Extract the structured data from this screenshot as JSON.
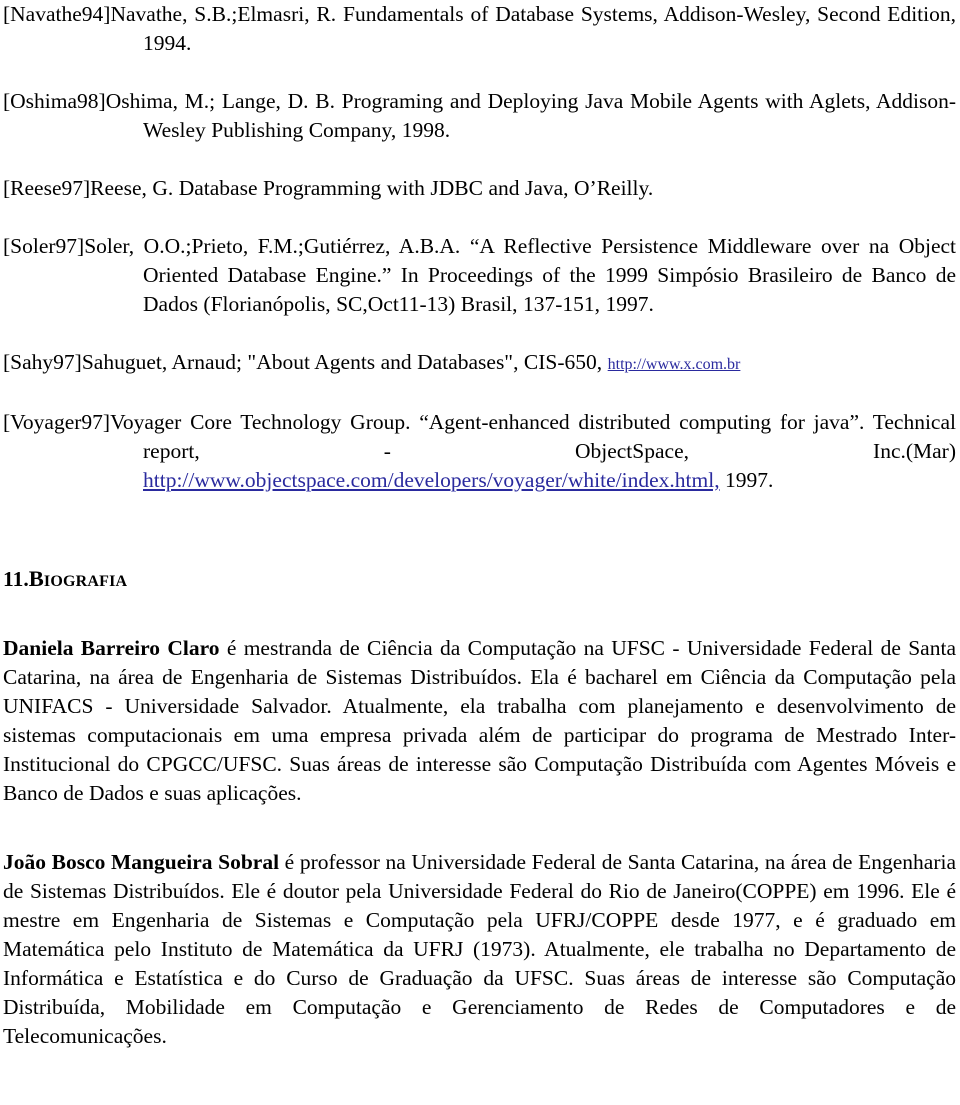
{
  "document": {
    "references": [
      {
        "key": "[Navathe94]",
        "text": "Navathe, S.B.;Elmasri, R. Fundamentals of Database Systems, Addison-Wesley, Second Edition, 1994."
      },
      {
        "key": "[Oshima98]",
        "text": "Oshima, M.; Lange, D. B. Programing and Deploying Java Mobile Agents with Aglets, Addison-Wesley Publishing Company, 1998."
      },
      {
        "key": "[Reese97]",
        "text": "Reese, G. Database Programming with JDBC and Java, O’Reilly."
      },
      {
        "key": "[Soler97]",
        "text": "Soler, O.O.;Prieto, F.M.;Gutiérrez, A.B.A. “A Reflective Persistence Middleware over na Object Oriented Database Engine.” In Proceedings of the 1999 Simpósio Brasileiro de Banco de Dados (Florianópolis, SC,Oct11-13) Brasil, 137-151, 1997."
      },
      {
        "key": "[Sahy97]",
        "text_before": "Sahuguet, Arnaud; \"About Agents and Databases\", CIS-650, ",
        "link": "http://www.x.com.br",
        "text_after": ""
      },
      {
        "key": "[Voyager97]",
        "text_before": "Voyager Core Technology Group. “Agent-enhanced distributed computing for java”. Technical report, - ObjectSpace, Inc.(Mar) ",
        "link": "http://www.objectspace.com/developers/voyager/white/index.html,",
        "text_after": " 1997."
      }
    ],
    "section": {
      "number": "11.",
      "title": "Biografia"
    },
    "biographies": [
      {
        "name": "Daniela Barreiro Claro",
        "text": " é mestranda de Ciência da Computação na UFSC - Universidade Federal de Santa Catarina, na área de Engenharia de Sistemas Distribuídos. Ela é bacharel em Ciência da Computação pela UNIFACS - Universidade Salvador. Atualmente, ela trabalha com planejamento e desenvolvimento de sistemas computacionais em uma empresa privada além de participar do programa de Mestrado Inter-Institucional do CPGCC/UFSC. Suas áreas de interesse são Computação Distribuída com Agentes Móveis e Banco de Dados e suas aplicações."
      },
      {
        "name": "João Bosco Mangueira Sobral",
        "text": " é professor na Universidade Federal de Santa Catarina, na área de Engenharia de Sistemas Distribuídos. Ele é doutor pela Universidade Federal do Rio de Janeiro(COPPE) em 1996. Ele é mestre em Engenharia de Sistemas e Computação pela UFRJ/COPPE desde 1977, e é graduado em Matemática pelo Instituto de Matemática da UFRJ (1973). Atualmente, ele trabalha no Departamento de Informática e Estatística e do Curso de Graduação da UFSC. Suas áreas de interesse são Computação Distribuída, Mobilidade em Computação e Gerenciamento de Redes de Computadores e de Telecomunicações."
      }
    ],
    "colors": {
      "link": "#2a2a9e",
      "text": "#000000",
      "background": "#ffffff"
    }
  }
}
